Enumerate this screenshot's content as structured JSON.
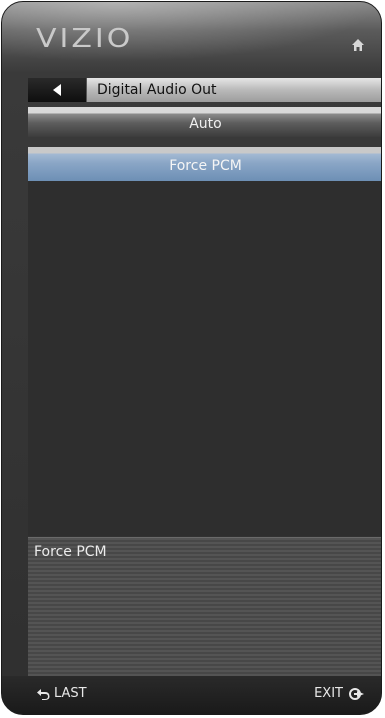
{
  "header": {
    "logo": "VIZIO",
    "home_icon": "home-icon"
  },
  "titlebar": {
    "back_icon": "left-arrow-icon",
    "title": "Digital Audio Out"
  },
  "options": [
    {
      "label": "Auto",
      "selected": false
    },
    {
      "label": "Force PCM",
      "selected": true
    }
  ],
  "description": {
    "text": "Force PCM"
  },
  "footer": {
    "last_label": "LAST",
    "last_icon": "return-arrow-icon",
    "exit_label": "EXIT",
    "exit_icon": "exit-icon"
  },
  "colors": {
    "selected_highlight": "#8aa6c6",
    "panel_dark": "#2e2e2e"
  }
}
